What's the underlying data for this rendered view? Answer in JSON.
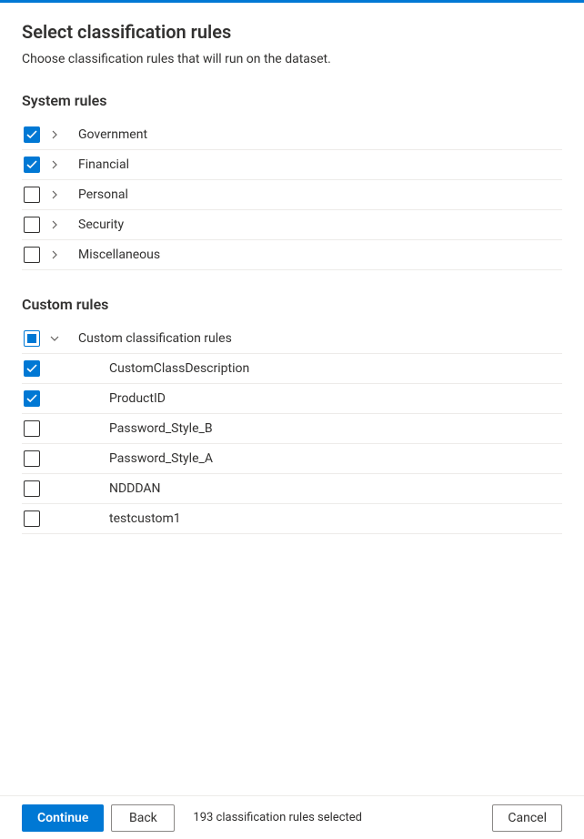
{
  "header": {
    "title": "Select classification rules",
    "subtitle": "Choose classification rules that will run on the dataset."
  },
  "sections": {
    "system": {
      "title": "System rules",
      "rules": [
        {
          "label": "Government",
          "checked": true,
          "expandable": true,
          "expanded": false
        },
        {
          "label": "Financial",
          "checked": true,
          "expandable": true,
          "expanded": false
        },
        {
          "label": "Personal",
          "checked": false,
          "expandable": true,
          "expanded": false
        },
        {
          "label": "Security",
          "checked": false,
          "expandable": true,
          "expanded": false
        },
        {
          "label": "Miscellaneous",
          "checked": false,
          "expandable": true,
          "expanded": false
        }
      ]
    },
    "custom": {
      "title": "Custom rules",
      "parent": {
        "label": "Custom classification rules",
        "state": "indeterminate",
        "expanded": true
      },
      "children": [
        {
          "label": "CustomClassDescription",
          "checked": true
        },
        {
          "label": "ProductID",
          "checked": true
        },
        {
          "label": "Password_Style_B",
          "checked": false
        },
        {
          "label": "Password_Style_A",
          "checked": false
        },
        {
          "label": "NDDDAN",
          "checked": false
        },
        {
          "label": "testcustom1",
          "checked": false
        }
      ]
    }
  },
  "footer": {
    "continue_label": "Continue",
    "back_label": "Back",
    "cancel_label": "Cancel",
    "status": "193 classification rules selected"
  }
}
